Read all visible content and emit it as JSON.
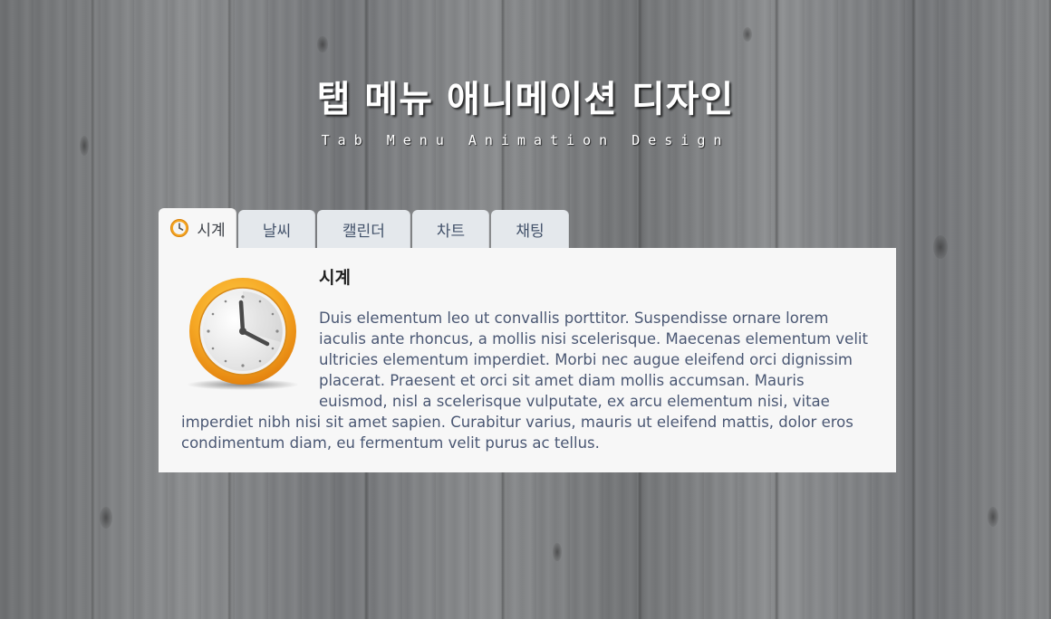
{
  "header": {
    "title": "탭 메뉴 애니메이션 디자인",
    "subtitle": "Tab Menu Animation Design"
  },
  "tabs": [
    {
      "label": "시계",
      "icon": "clock-icon",
      "active": true
    },
    {
      "label": "날씨",
      "active": false
    },
    {
      "label": "캘린더",
      "active": false
    },
    {
      "label": "차트",
      "active": false
    },
    {
      "label": "채팅",
      "active": false
    }
  ],
  "panel": {
    "title": "시계",
    "image_icon": "clock-icon",
    "text": "Duis elementum leo ut convallis porttitor. Suspendisse ornare lorem iaculis ante rhoncus, a mollis nisi scelerisque. Maecenas elementum velit ultricies elementum imperdiet. Morbi nec augue eleifend orci dignissim placerat. Praesent et orci sit amet diam mollis accumsan. Mauris euismod, nisl a scelerisque vulputate, ex arcu elementum nisi, vitae imperdiet nibh nisi sit amet sapien. Curabitur varius, mauris ut eleifend mattis, dolor eros condimentum diam, eu fermentum velit purus ac tellus."
  },
  "colors": {
    "background": "#7d7f81",
    "tab_inactive": "#e4e8ec",
    "tab_active": "#f7f7f7",
    "panel_bg": "#f7f7f7",
    "tab_text": "#43526a",
    "body_text": "#4a5773",
    "clock_orange": "#f39c12"
  }
}
